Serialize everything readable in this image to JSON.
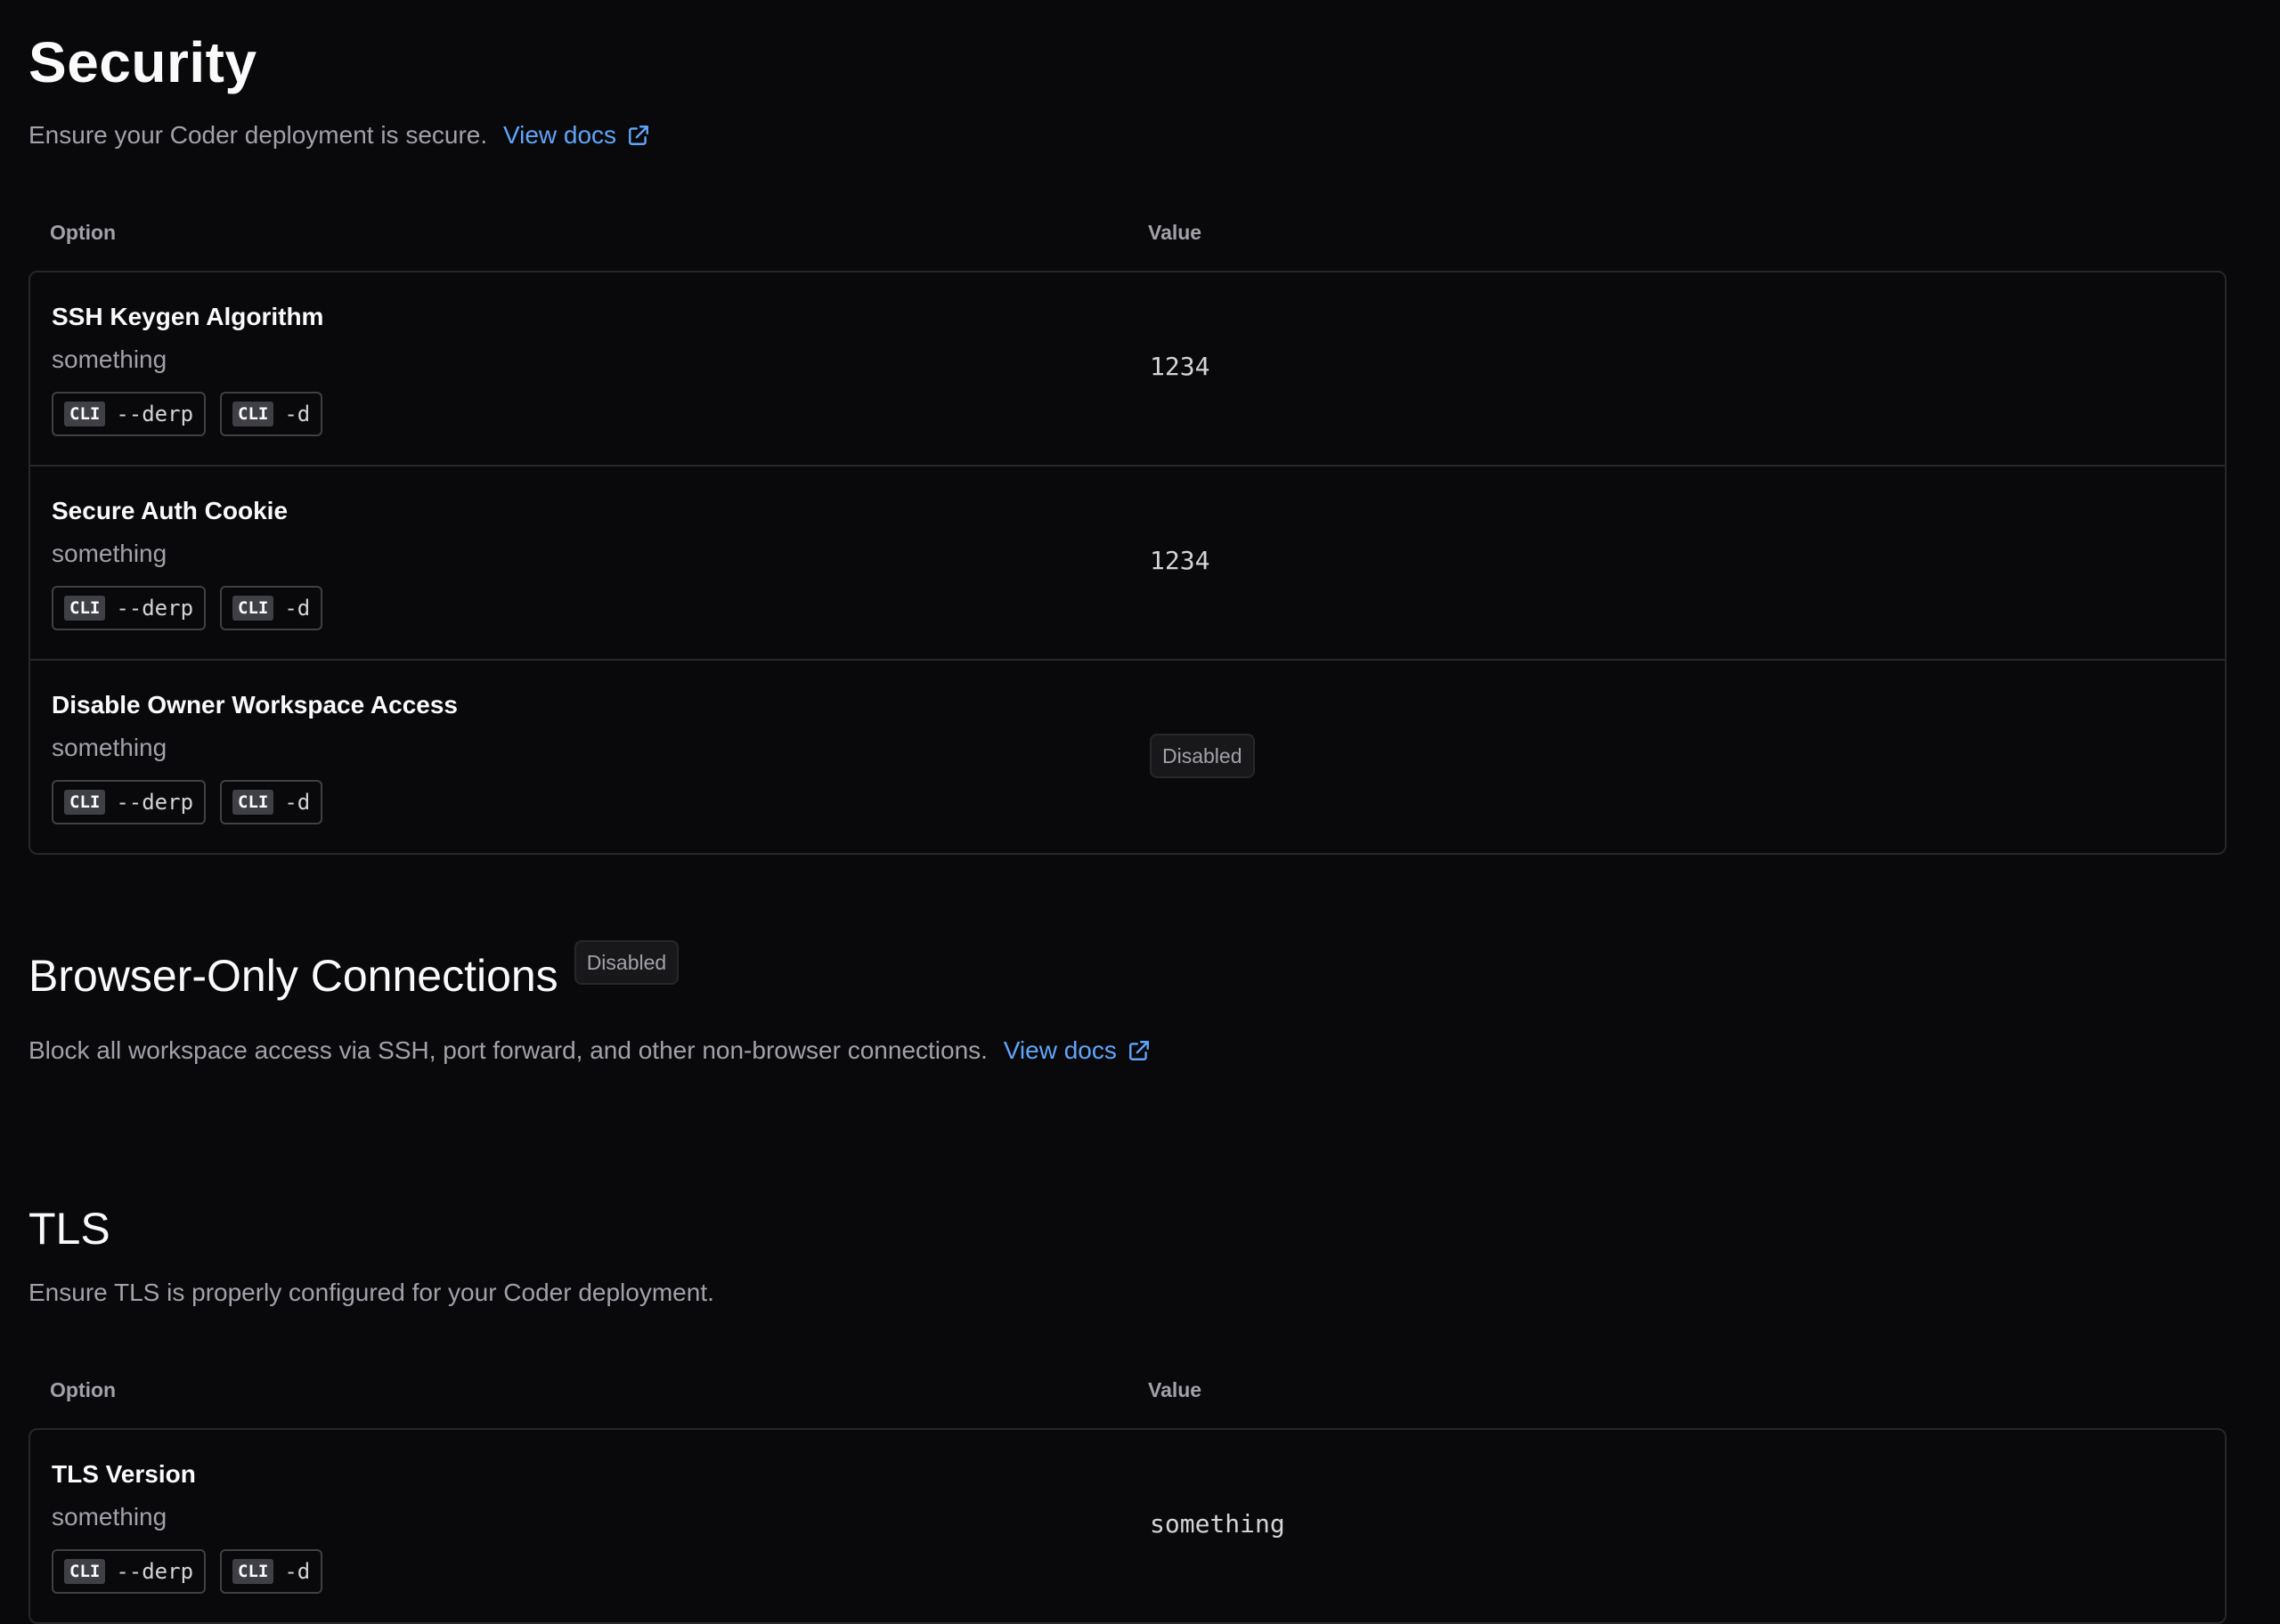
{
  "security": {
    "title": "Security",
    "description": "Ensure your Coder deployment is secure.",
    "docs_label": "View docs",
    "columns": {
      "option": "Option",
      "value": "Value"
    },
    "rows": [
      {
        "title": "SSH Keygen Algorithm",
        "description": "something",
        "flags": [
          {
            "tag": "CLI",
            "flag": "--derp"
          },
          {
            "tag": "CLI",
            "flag": "-d"
          }
        ],
        "value": "1234"
      },
      {
        "title": "Secure Auth Cookie",
        "description": "something",
        "flags": [
          {
            "tag": "CLI",
            "flag": "--derp"
          },
          {
            "tag": "CLI",
            "flag": "-d"
          }
        ],
        "value": "1234"
      },
      {
        "title": "Disable Owner Workspace Access",
        "description": "something",
        "flags": [
          {
            "tag": "CLI",
            "flag": "--derp"
          },
          {
            "tag": "CLI",
            "flag": "-d"
          }
        ],
        "value_badge": "Disabled"
      }
    ]
  },
  "browser_only": {
    "title": "Browser-Only Connections",
    "badge": "Disabled",
    "description": "Block all workspace access via SSH, port forward, and other non-browser connections.",
    "docs_label": "View docs"
  },
  "tls": {
    "title": "TLS",
    "description": "Ensure TLS is properly configured for your Coder deployment.",
    "columns": {
      "option": "Option",
      "value": "Value"
    },
    "rows": [
      {
        "title": "TLS Version",
        "description": "something",
        "flags": [
          {
            "tag": "CLI",
            "flag": "--derp"
          },
          {
            "tag": "CLI",
            "flag": "-d"
          }
        ],
        "value": "something"
      }
    ]
  },
  "colors": {
    "background": "#09090b",
    "link": "#60a5fa",
    "border": "#27272a",
    "muted_text": "#a1a1aa"
  }
}
